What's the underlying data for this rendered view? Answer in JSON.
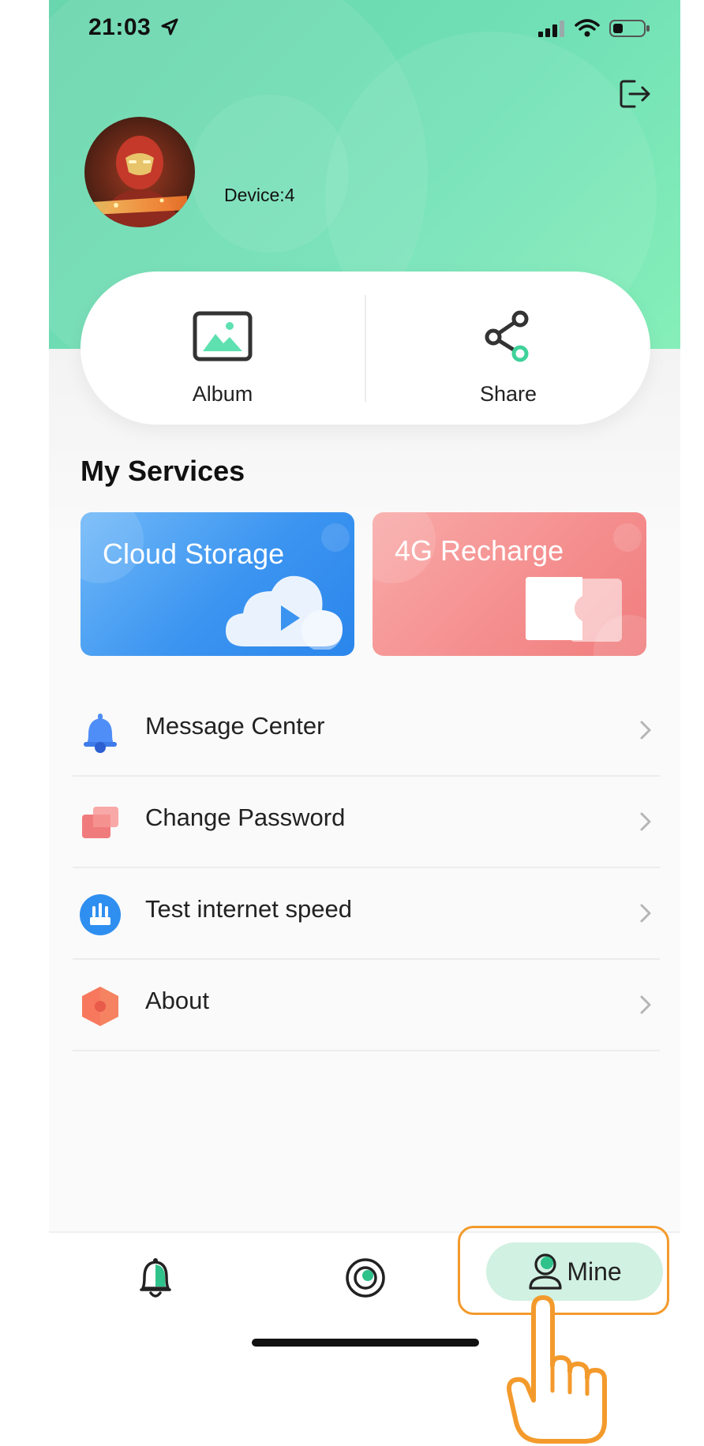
{
  "status_bar": {
    "time": "21:03"
  },
  "profile": {
    "device_count": "Device:4"
  },
  "quick_actions": [
    {
      "label": "Album",
      "icon": "album-icon"
    },
    {
      "label": "Share",
      "icon": "share-icon"
    }
  ],
  "services": {
    "title": "My Services",
    "cards": [
      {
        "label": "Cloud Storage",
        "icon": "cloud-play-icon"
      },
      {
        "label": "4G Recharge",
        "icon": "sim-card-icon"
      }
    ]
  },
  "menu": [
    {
      "label": "Message Center",
      "icon": "bell-icon"
    },
    {
      "label": "Change Password",
      "icon": "password-icon"
    },
    {
      "label": "Test internet speed",
      "icon": "speed-test-icon"
    },
    {
      "label": "About",
      "icon": "hexagon-info-icon"
    }
  ],
  "tabbar": {
    "tabs": [
      {
        "name": "alarm",
        "icon": "bell-icon"
      },
      {
        "name": "camera",
        "icon": "camera-icon"
      },
      {
        "name": "mine",
        "icon": "user-icon",
        "label": "Mine",
        "active": true
      }
    ]
  },
  "colors": {
    "header_green": "#71e0b6",
    "accent_green": "#2fc28a",
    "active_tab_bg": "#d1f1e2",
    "cloud_blue": "#3b94f0",
    "recharge_red": "#f58f8f",
    "highlight_orange": "#f39a2c"
  }
}
